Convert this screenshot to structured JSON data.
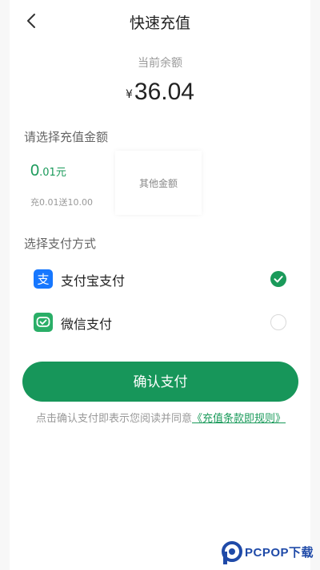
{
  "header": {
    "title": "快速充值"
  },
  "balance": {
    "label": "当前余额",
    "currency": "¥",
    "amount": "36.04"
  },
  "amount_section": {
    "title": "请选择充值金额",
    "option": {
      "amount_int": "0",
      "amount_dec": ".01",
      "unit": "元",
      "gift": "充0.01送10.00"
    },
    "other_label": "其他金额"
  },
  "payment_section": {
    "title": "选择支付方式",
    "methods": [
      {
        "label": "支付宝支付",
        "selected": true,
        "color": "#1677ff"
      },
      {
        "label": "微信支付",
        "selected": false,
        "color": "#2aae67"
      }
    ]
  },
  "confirm_button": {
    "label": "确认支付"
  },
  "agreement": {
    "prefix": "点击确认支付即表示您阅读并同意",
    "link": "《充值条款即规则》"
  },
  "watermark": {
    "brand": "PCPOP下载"
  },
  "colors": {
    "accent": "#17965a"
  }
}
